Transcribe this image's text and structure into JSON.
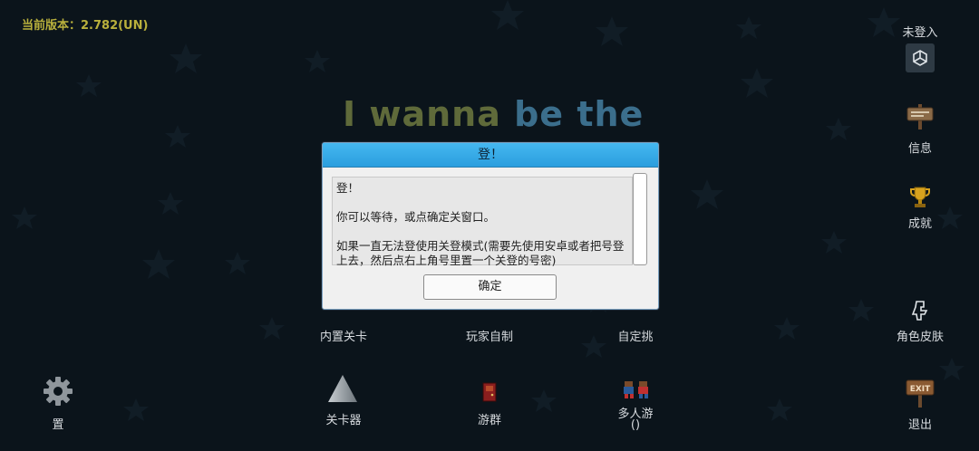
{
  "version_text": "当前版本：2.782(UN)",
  "title": {
    "part1": "I wanna",
    "part2": "be the"
  },
  "account": {
    "status": "未登入"
  },
  "right_menu": {
    "info": "信息",
    "achievements": "成就",
    "skins": "角色皮肤",
    "exit": "退出"
  },
  "main_menu": {
    "builtin_levels": "内置关卡",
    "player_made": "玩家自制",
    "custom_challenge": "自定挑"
  },
  "bottom_menu": {
    "settings": "置",
    "level_editor": "关卡器",
    "game_group": "游群",
    "multiplayer_line1": "多人游",
    "multiplayer_line2": "()"
  },
  "dialog": {
    "title": "登！",
    "line1": "登！",
    "line2": "你可以等待，或点确定关窗口。",
    "line3": "如果一直无法登使用关登模式(需要先使用安卓或者把号登上去，然后点右上角号里置一个关登的号密)",
    "ok": "确定"
  },
  "colors": {
    "background": "#0b141b",
    "version": "#b9b03c",
    "dialog_title": "#2b9ede"
  },
  "icons": [
    "unity-icon",
    "signboard-icon",
    "trophy-icon",
    "character-icon",
    "exit-sign-icon",
    "gear-icon",
    "triangle-icon",
    "door-icon",
    "players-icon"
  ]
}
